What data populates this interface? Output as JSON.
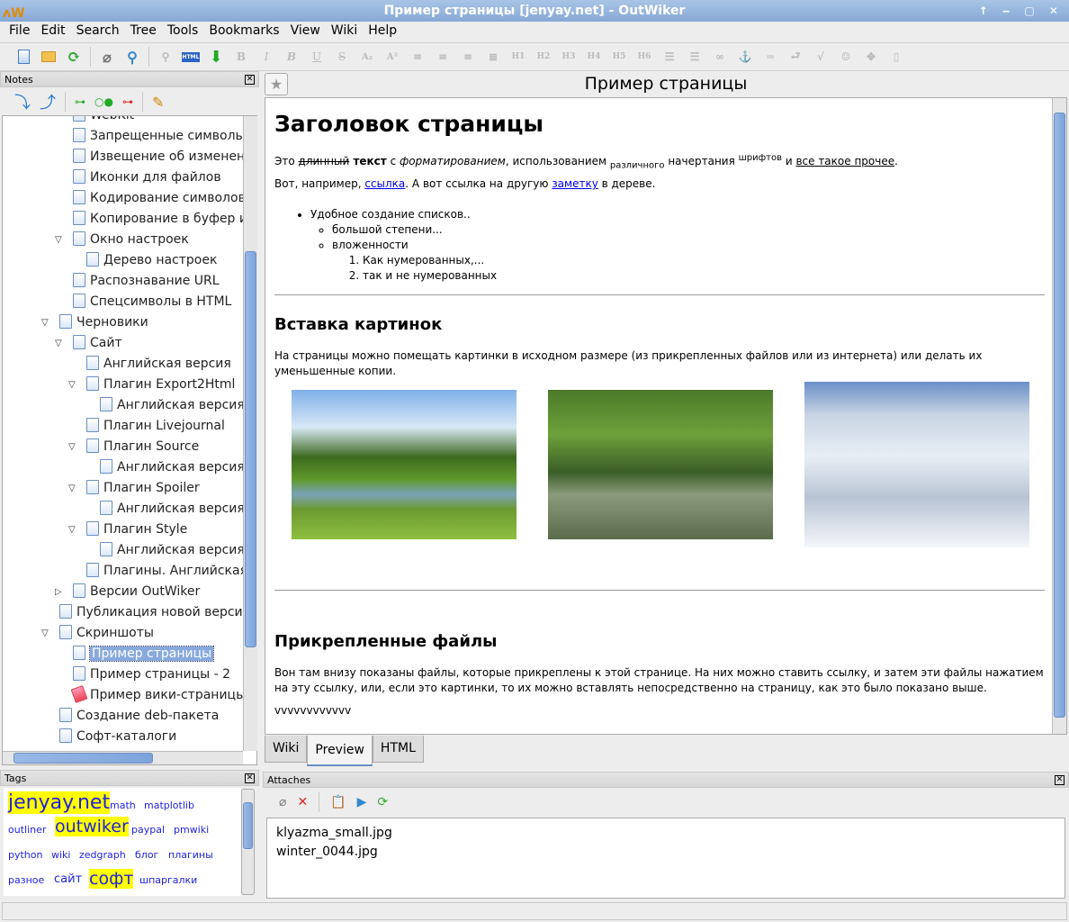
{
  "window": {
    "title": "Пример страницы [jenyay.net] - OutWiker",
    "controls": "↑ ‒ ▢ ✕"
  },
  "menu": [
    "File",
    "Edit",
    "Search",
    "Tree",
    "Tools",
    "Bookmarks",
    "View",
    "Wiki",
    "Help"
  ],
  "toolbar": {
    "icons": [
      "new-page-icon",
      "open-icon",
      "reload-icon",
      "attach-icon",
      "global-search-icon",
      "search-icon",
      "html-icon",
      "export-binary-icon",
      "bold-icon",
      "italic-icon",
      "bold-italic-icon",
      "underline-icon",
      "strike-icon",
      "subscript-icon",
      "superscript-icon",
      "align-left-icon",
      "align-center-icon",
      "align-right-icon",
      "justify-icon",
      "h1-icon",
      "h2-icon",
      "h3-icon",
      "h4-icon",
      "h5-icon",
      "h6-icon",
      "bullet-list-icon",
      "numbered-list-icon",
      "link-icon",
      "anchor-icon",
      "hr-icon",
      "return-icon",
      "equation-icon",
      "user-icon",
      "move-icon",
      "file-icon"
    ],
    "labels": {
      "bold": "B",
      "italic": "I",
      "bold_italic": "B",
      "underline": "U",
      "strike": "S",
      "sub": "A₂",
      "sup": "A²",
      "h1": "H1",
      "h2": "H2",
      "h3": "H3",
      "h4": "H4",
      "h5": "H5",
      "h6": "H6",
      "html": "HTML"
    }
  },
  "notes": {
    "title": "Notes",
    "tree": [
      {
        "label": "WebKit",
        "level": 1
      },
      {
        "label": "Запрещенные символы",
        "level": 1
      },
      {
        "label": "Извещение об изменени",
        "level": 1
      },
      {
        "label": "Иконки для файлов",
        "level": 1
      },
      {
        "label": "Кодирование символов",
        "level": 1
      },
      {
        "label": "Копирование в буфер из",
        "level": 1
      },
      {
        "label": "Окно настроек",
        "level": 1,
        "expander": "open"
      },
      {
        "label": "Дерево настроек",
        "level": 2
      },
      {
        "label": "Распознавание URL",
        "level": 1
      },
      {
        "label": "Спецсимволы в HTML",
        "level": 1
      },
      {
        "label": "Черновики",
        "level": 0,
        "expander": "open"
      },
      {
        "label": "Сайт",
        "level": 1,
        "expander": "open"
      },
      {
        "label": "Английская версия",
        "level": 2
      },
      {
        "label": "Плагин Export2Html",
        "level": 2,
        "expander": "open"
      },
      {
        "label": "Английская версия",
        "level": 3
      },
      {
        "label": "Плагин Livejournal",
        "level": 2
      },
      {
        "label": "Плагин Source",
        "level": 2,
        "expander": "open"
      },
      {
        "label": "Английская версия",
        "level": 3
      },
      {
        "label": "Плагин Spoiler",
        "level": 2,
        "expander": "open"
      },
      {
        "label": "Английская версия",
        "level": 3
      },
      {
        "label": "Плагин Style",
        "level": 2,
        "expander": "open"
      },
      {
        "label": "Английская версия",
        "level": 3
      },
      {
        "label": "Плагины. Английская",
        "level": 2
      },
      {
        "label": "Версии OutWiker",
        "level": 1,
        "expander": "closed"
      },
      {
        "label": "Публикация новой версии",
        "level": 0
      },
      {
        "label": "Скриншоты",
        "level": 0,
        "expander": "open"
      },
      {
        "label": "Пример страницы",
        "level": 1,
        "selected": true
      },
      {
        "label": "Пример страницы - 2",
        "level": 1
      },
      {
        "label": "Пример вики-страницы",
        "level": 1,
        "wiki": true
      },
      {
        "label": "Создание deb-пакета",
        "level": 0
      },
      {
        "label": "Софт-каталоги",
        "level": 0
      }
    ]
  },
  "page": {
    "title": "Пример страницы",
    "h1": "Заголовок страницы",
    "p1": {
      "a": "Это ",
      "strike": "длинный",
      "b": " текст",
      "c": " с ",
      "italic": "форматированием",
      "d": ", использованием ",
      "sub": "различного",
      "e": " начертания ",
      "sup": "шрифтов",
      "f": " и ",
      "underline": "все такое прочее",
      "g": "."
    },
    "p2": {
      "a": "Вот, например, ",
      "link1": "ссылка",
      "b": ". А вот ссылка на другую ",
      "link2": "заметку",
      "c": " в дереве."
    },
    "list": {
      "item": "Удобное создание списков..",
      "sub": [
        "большой степени...",
        "вложенности"
      ],
      "numbered": [
        "Как нумерованных,...",
        "так и не нумерованных"
      ]
    },
    "h2a": "Вставка картинок",
    "p3": "На страницы можно помещать картинки в исходном размере (из прикрепленных файлов или из интернета) или делать их уменьшенные копии.",
    "h2b": "Прикрепленные файлы",
    "p4": "Вон там внизу показаны файлы, которые прикреплены к этой странице. На них можно ставить ссылку, и затем эти файлы нажатием на эту ссылку, или, если это картинки, то их можно вставлять непосредственно на страницу, как это было показано выше.",
    "p5": "vvvvvvvvvvvv",
    "tabs": [
      "Wiki",
      "Preview",
      "HTML"
    ],
    "active_tab": "Preview"
  },
  "tags": {
    "title": "Tags",
    "items": [
      {
        "t": "jenyay.net",
        "hl": true
      },
      {
        "t": "math"
      },
      {
        "t": "matplotlib"
      },
      {
        "t": "outliner"
      },
      {
        "t": "outwiker",
        "hl": true
      },
      {
        "t": "paypal"
      },
      {
        "t": "pmwiki"
      },
      {
        "t": "python"
      },
      {
        "t": "wiki"
      },
      {
        "t": "zedgraph"
      },
      {
        "t": "блог"
      },
      {
        "t": "плагины"
      },
      {
        "t": "разное"
      },
      {
        "t": "сайт"
      },
      {
        "t": "софт",
        "hl": true
      },
      {
        "t": "шпаргалки"
      }
    ]
  },
  "attaches": {
    "title": "Attaches",
    "files": [
      "klyazma_small.jpg",
      "winter_0044.jpg"
    ]
  },
  "colors": {
    "selection": "#88a9dd",
    "tag_highlight": "#ffff00",
    "link": "#0000ee",
    "titlebar": "#86a9d6"
  }
}
